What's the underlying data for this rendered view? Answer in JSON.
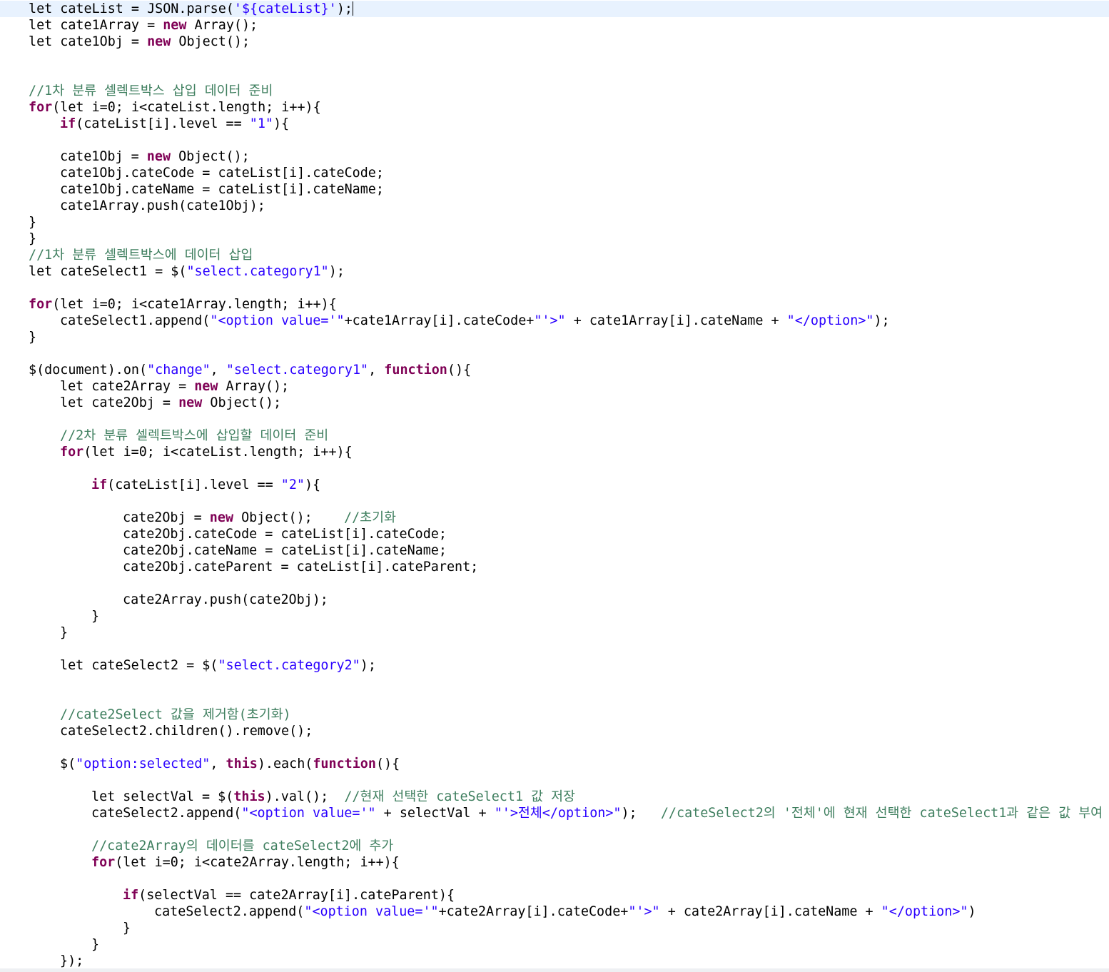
{
  "editor": {
    "lines": [
      {
        "indent": 0,
        "tokens": [
          {
            "t": "let cateList = JSON.parse("
          },
          {
            "t": "'${cateList}'",
            "c": "str"
          },
          {
            "t": ");"
          }
        ],
        "current": true
      },
      {
        "indent": 0,
        "tokens": [
          {
            "t": "let cate1Array = "
          },
          {
            "t": "new",
            "c": "kw"
          },
          {
            "t": " Array();"
          }
        ]
      },
      {
        "indent": 0,
        "tokens": [
          {
            "t": "let cate1Obj = "
          },
          {
            "t": "new",
            "c": "kw"
          },
          {
            "t": " Object();"
          }
        ]
      },
      {
        "indent": 0,
        "tokens": []
      },
      {
        "indent": 0,
        "tokens": []
      },
      {
        "indent": 0,
        "tokens": [
          {
            "t": "//1차 분류 셀렉트박스 삽입 데이터 준비",
            "c": "cm"
          }
        ]
      },
      {
        "indent": 0,
        "tokens": [
          {
            "t": "for",
            "c": "kw"
          },
          {
            "t": "(let i=0; i<cateList.length; i++){"
          }
        ]
      },
      {
        "indent": 1,
        "tokens": [
          {
            "t": "if",
            "c": "kw"
          },
          {
            "t": "(cateList[i].level == "
          },
          {
            "t": "\"1\"",
            "c": "str"
          },
          {
            "t": "){"
          }
        ]
      },
      {
        "indent": 0,
        "tokens": []
      },
      {
        "indent": 1,
        "tokens": [
          {
            "t": "cate1Obj = "
          },
          {
            "t": "new",
            "c": "kw"
          },
          {
            "t": " Object();"
          }
        ]
      },
      {
        "indent": 1,
        "tokens": [
          {
            "t": "cate1Obj.cateCode = cateList[i].cateCode;"
          }
        ]
      },
      {
        "indent": 1,
        "tokens": [
          {
            "t": "cate1Obj.cateName = cateList[i].cateName;"
          }
        ]
      },
      {
        "indent": 1,
        "tokens": [
          {
            "t": "cate1Array.push(cate1Obj);"
          }
        ]
      },
      {
        "indent": 0,
        "tokens": [
          {
            "t": "}"
          }
        ]
      },
      {
        "indent": -1,
        "tokens": [
          {
            "t": "}"
          }
        ]
      },
      {
        "indent": 0,
        "tokens": [
          {
            "t": "//1차 분류 셀렉트박스에 데이터 삽입",
            "c": "cm"
          }
        ]
      },
      {
        "indent": 0,
        "tokens": [
          {
            "t": "let cateSelect1 = $("
          },
          {
            "t": "\"select.category1\"",
            "c": "str"
          },
          {
            "t": ");"
          }
        ]
      },
      {
        "indent": 0,
        "tokens": []
      },
      {
        "indent": 0,
        "tokens": [
          {
            "t": "for",
            "c": "kw"
          },
          {
            "t": "(let i=0; i<cate1Array.length; i++){"
          }
        ]
      },
      {
        "indent": 1,
        "tokens": [
          {
            "t": "cateSelect1.append("
          },
          {
            "t": "\"<option value='\"",
            "c": "str"
          },
          {
            "t": "+cate1Array[i].cateCode+"
          },
          {
            "t": "\"'>\"",
            "c": "str"
          },
          {
            "t": " + cate1Array[i].cateName + "
          },
          {
            "t": "\"</option>\"",
            "c": "str"
          },
          {
            "t": ");"
          }
        ]
      },
      {
        "indent": 0,
        "tokens": [
          {
            "t": "}"
          }
        ]
      },
      {
        "indent": 0,
        "tokens": []
      },
      {
        "indent": 0,
        "tokens": [
          {
            "t": "$(document).on("
          },
          {
            "t": "\"change\"",
            "c": "str"
          },
          {
            "t": ", "
          },
          {
            "t": "\"select.category1\"",
            "c": "str"
          },
          {
            "t": ", "
          },
          {
            "t": "function",
            "c": "kw"
          },
          {
            "t": "(){"
          }
        ]
      },
      {
        "indent": 1,
        "tokens": [
          {
            "t": "let cate2Array = "
          },
          {
            "t": "new",
            "c": "kw"
          },
          {
            "t": " Array();"
          }
        ]
      },
      {
        "indent": 1,
        "tokens": [
          {
            "t": "let cate2Obj = "
          },
          {
            "t": "new",
            "c": "kw"
          },
          {
            "t": " Object();"
          }
        ]
      },
      {
        "indent": 0,
        "tokens": []
      },
      {
        "indent": 1,
        "tokens": [
          {
            "t": "//2차 분류 셀렉트박스에 삽입할 데이터 준비",
            "c": "cm"
          }
        ]
      },
      {
        "indent": 1,
        "tokens": [
          {
            "t": "for",
            "c": "kw"
          },
          {
            "t": "(let i=0; i<cateList.length; i++){"
          }
        ]
      },
      {
        "indent": 0,
        "tokens": []
      },
      {
        "indent": 2,
        "tokens": [
          {
            "t": "if",
            "c": "kw"
          },
          {
            "t": "(cateList[i].level == "
          },
          {
            "t": "\"2\"",
            "c": "str"
          },
          {
            "t": "){"
          }
        ]
      },
      {
        "indent": 0,
        "tokens": []
      },
      {
        "indent": 3,
        "tokens": [
          {
            "t": "cate2Obj = "
          },
          {
            "t": "new",
            "c": "kw"
          },
          {
            "t": " Object();    "
          },
          {
            "t": "//초기화",
            "c": "cm"
          }
        ]
      },
      {
        "indent": 3,
        "tokens": [
          {
            "t": "cate2Obj.cateCode = cateList[i].cateCode;"
          }
        ]
      },
      {
        "indent": 3,
        "tokens": [
          {
            "t": "cate2Obj.cateName = cateList[i].cateName;"
          }
        ]
      },
      {
        "indent": 3,
        "tokens": [
          {
            "t": "cate2Obj.cateParent = cateList[i].cateParent;"
          }
        ]
      },
      {
        "indent": 0,
        "tokens": []
      },
      {
        "indent": 3,
        "tokens": [
          {
            "t": "cate2Array.push(cate2Obj);"
          }
        ]
      },
      {
        "indent": 2,
        "tokens": [
          {
            "t": "}"
          }
        ]
      },
      {
        "indent": 1,
        "tokens": [
          {
            "t": "}"
          }
        ]
      },
      {
        "indent": 0,
        "tokens": []
      },
      {
        "indent": 1,
        "tokens": [
          {
            "t": "let cateSelect2 = $("
          },
          {
            "t": "\"select.category2\"",
            "c": "str"
          },
          {
            "t": ");"
          }
        ]
      },
      {
        "indent": 0,
        "tokens": []
      },
      {
        "indent": 0,
        "tokens": []
      },
      {
        "indent": 1,
        "tokens": [
          {
            "t": "//cate2Select 값을 제거함(초기화)",
            "c": "cm"
          }
        ]
      },
      {
        "indent": 1,
        "tokens": [
          {
            "t": "cateSelect2.children().remove();"
          }
        ]
      },
      {
        "indent": 0,
        "tokens": []
      },
      {
        "indent": 1,
        "tokens": [
          {
            "t": "$("
          },
          {
            "t": "\"option:selected\"",
            "c": "str"
          },
          {
            "t": ", "
          },
          {
            "t": "this",
            "c": "kw"
          },
          {
            "t": ").each("
          },
          {
            "t": "function",
            "c": "kw"
          },
          {
            "t": "(){"
          }
        ]
      },
      {
        "indent": 0,
        "tokens": []
      },
      {
        "indent": 2,
        "tokens": [
          {
            "t": "let selectVal = $("
          },
          {
            "t": "this",
            "c": "kw"
          },
          {
            "t": ").val();  "
          },
          {
            "t": "//현재 선택한 cateSelect1 값 저장",
            "c": "cm"
          }
        ]
      },
      {
        "indent": 2,
        "tokens": [
          {
            "t": "cateSelect2.append("
          },
          {
            "t": "\"<option value='\"",
            "c": "str"
          },
          {
            "t": " + selectVal + "
          },
          {
            "t": "\"'>전체</option>\"",
            "c": "str"
          },
          {
            "t": ");   "
          },
          {
            "t": "//cateSelect2의 '전체'에 현재 선택한 cateSelect1과 같은 값 부여",
            "c": "cm"
          }
        ]
      },
      {
        "indent": 0,
        "tokens": []
      },
      {
        "indent": 2,
        "tokens": [
          {
            "t": "//cate2Array의 데이터를 cateSelect2에 추가",
            "c": "cm"
          }
        ]
      },
      {
        "indent": 2,
        "tokens": [
          {
            "t": "for",
            "c": "kw"
          },
          {
            "t": "(let i=0; i<cate2Array.length; i++){"
          }
        ]
      },
      {
        "indent": 0,
        "tokens": []
      },
      {
        "indent": 3,
        "tokens": [
          {
            "t": "if",
            "c": "kw"
          },
          {
            "t": "(selectVal == cate2Array[i].cateParent){"
          }
        ]
      },
      {
        "indent": 4,
        "tokens": [
          {
            "t": "cateSelect2.append("
          },
          {
            "t": "\"<option value='\"",
            "c": "str"
          },
          {
            "t": "+cate2Array[i].cateCode+"
          },
          {
            "t": "\"'>\"",
            "c": "str"
          },
          {
            "t": " + cate2Array[i].cateName + "
          },
          {
            "t": "\"</option>\"",
            "c": "str"
          },
          {
            "t": ")"
          }
        ]
      },
      {
        "indent": 3,
        "tokens": [
          {
            "t": "}"
          }
        ]
      },
      {
        "indent": 2,
        "tokens": [
          {
            "t": "}"
          }
        ]
      },
      {
        "indent": 1,
        "tokens": [
          {
            "t": "});"
          }
        ]
      }
    ]
  }
}
